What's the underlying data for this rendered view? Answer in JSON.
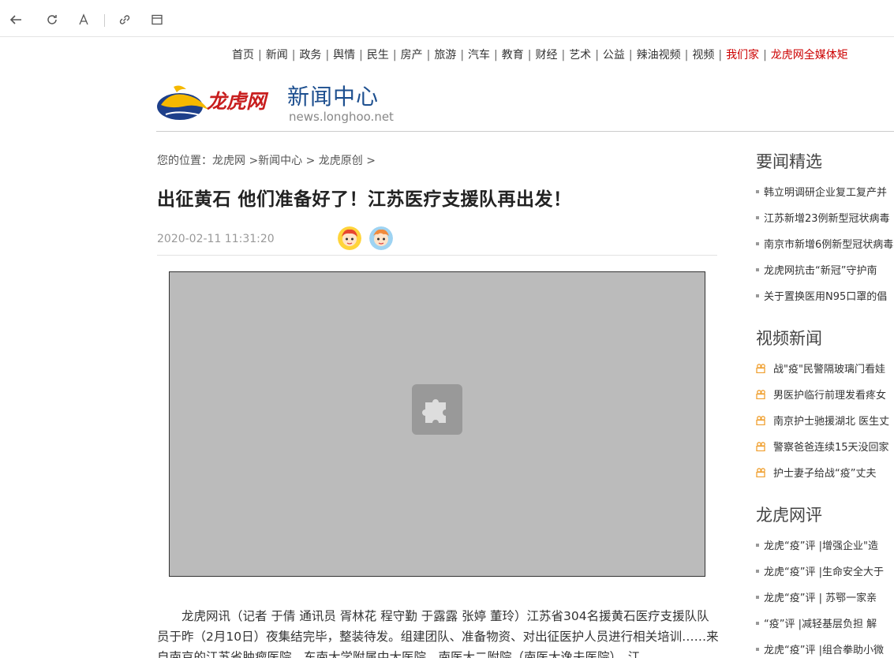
{
  "browser": {
    "back_icon": "back-arrow-icon",
    "reload_icon": "reload-icon",
    "reader_icon": "font-icon",
    "link_icon": "link-icon",
    "window_icon": "window-icon"
  },
  "topnav": {
    "items": [
      "首页",
      "新闻",
      "政务",
      "舆情",
      "民生",
      "房产",
      "旅游",
      "汽车",
      "教育",
      "财经",
      "艺术",
      "公益",
      "辣油视频",
      "视频",
      "我们家",
      "龙虎网全媒体矩"
    ],
    "separator": "|",
    "highlight_color": "#cc0000"
  },
  "header": {
    "logo_text": "龙虎网",
    "title": "新闻中心",
    "domain": "news.longhoo.net"
  },
  "breadcrumb": "您的位置：龙虎网 >新闻中心 > 龙虎原创 >",
  "article": {
    "title": "出征黄石 他们准备好了！江苏医疗支援队再出发！",
    "time": "2020-02-11 11:31:20",
    "share_icons": [
      "avatar-girl-icon",
      "avatar-boy-icon"
    ],
    "media_placeholder_icon": "puzzle-plugin-icon",
    "body": "龙虎网讯（记者 于倩  通讯员 胥林花 程守勤 于露露 张婷 董玲）江苏省304名援黄石医疗支援队队员于昨（2月10日）夜集结完毕，整装待发。组建团队、准备物资、对出征医护人员进行相关培训……来自南京的江苏省肿瘤医院、东南大学附属中大医院、南医大二附院（南医大逸夫医院）、江"
  },
  "sidebar": {
    "sections": [
      {
        "title": "要闻精选",
        "items": [
          "韩立明调研企业复工复产并",
          "江苏新增23例新型冠状病毒",
          "南京市新增6例新型冠状病毒",
          "龙虎网抗击“新冠”守护南",
          "关于置换医用N95口罩的倡"
        ]
      },
      {
        "title": "视频新闻",
        "items": [
          "战\"疫\"民警隔玻璃门看娃",
          "男医护临行前理发看疼女",
          "南京护士驰援湖北 医生丈",
          "警察爸爸连续15天没回家",
          "护士妻子给战“疫”丈夫"
        ]
      },
      {
        "title": "龙虎网评",
        "items": [
          "龙虎“疫”评 |增强企业\"造",
          "龙虎“疫”评 |生命安全大于",
          "龙虎“疫”评 | 苏鄂一家亲",
          "“疫”评 |减轻基层负担 解",
          "龙虎“疫”评 |组合拳助小微"
        ]
      }
    ],
    "video_icon_color": "#f0a030"
  }
}
